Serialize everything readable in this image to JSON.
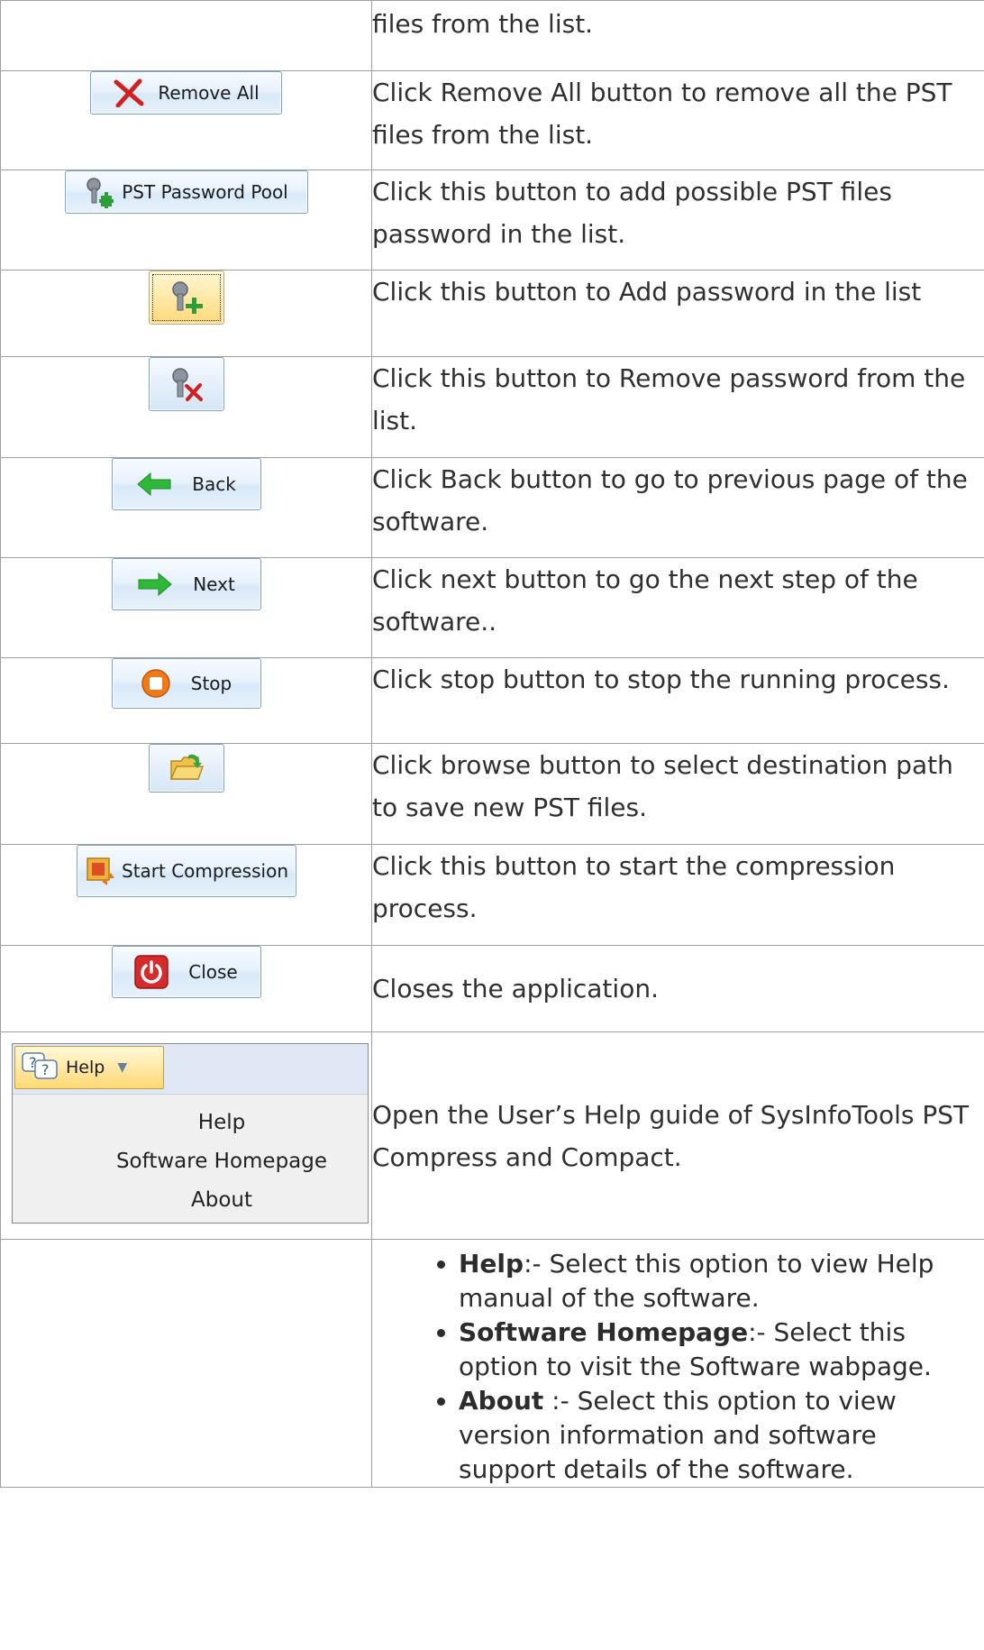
{
  "rows": [
    {
      "button_label": "",
      "description": "files from the list."
    },
    {
      "button_label": "Remove All",
      "description": "Click Remove All button to remove all the PST files from the list."
    },
    {
      "button_label": "PST Password Pool",
      "description": "Click this button to add possible PST files password in the list."
    },
    {
      "button_label": "",
      "description": "Click this button to Add password in the list"
    },
    {
      "button_label": "",
      "description": "Click this button to Remove password from the list."
    },
    {
      "button_label": "Back",
      "description": "Click Back button to go to previous page of the software."
    },
    {
      "button_label": "Next",
      "description": "Click next button to go the next step of the software.."
    },
    {
      "button_label": "Stop",
      "description": "Click stop button to stop the running process."
    },
    {
      "button_label": "",
      "description": "Click browse button to select destination path to save new PST files."
    },
    {
      "button_label": "Start Compression",
      "description": "Click this button to start the compression process."
    },
    {
      "button_label": "Close",
      "description": "Closes the application."
    }
  ],
  "help_menu": {
    "button_label": "Help",
    "items": [
      "Help",
      "Software Homepage",
      "About"
    ],
    "description": "Open the User’s Help guide of SysInfoTools PST Compress and Compact."
  },
  "features": [
    {
      "term": "Help",
      "sep": ":- ",
      "text": "Select this option to view Help manual of the software."
    },
    {
      "term": "Software Homepage",
      "sep": ":- ",
      "text": "Select this option to visit the Software wabpage."
    },
    {
      "term": "About",
      "sep": " :- ",
      "text": "Select this option to view version information and software support details of the software."
    }
  ],
  "icons": {
    "remove_all": "red-x-icon",
    "password_pool": "keys-plus-icon",
    "add_password": "keys-plus-icon",
    "remove_password": "keys-x-icon",
    "back": "green-left-arrow-icon",
    "next": "green-right-arrow-icon",
    "stop": "orange-stop-icon",
    "browse": "folder-open-icon",
    "start_compression": "compress-icon",
    "close": "red-power-icon",
    "help": "help-question-icon"
  }
}
